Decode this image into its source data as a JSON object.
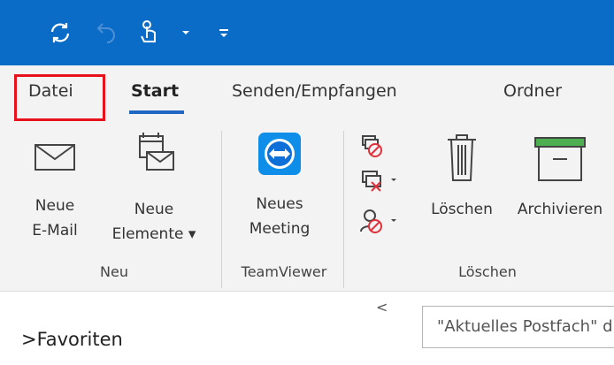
{
  "qat": {
    "items": [
      {
        "name": "sync-icon"
      },
      {
        "name": "undo-icon"
      },
      {
        "name": "touch-mode-icon"
      },
      {
        "name": "dropdown-icon"
      },
      {
        "name": "customize-icon"
      }
    ],
    "bg_color": "#0a6cc6"
  },
  "tabs": {
    "items": [
      {
        "label": "Datei"
      },
      {
        "label": "Start"
      },
      {
        "label": "Senden/Empfangen"
      },
      {
        "label": "Ordner"
      }
    ],
    "active": "Start",
    "highlight_color": "#e8101a"
  },
  "ribbon": {
    "groups": [
      {
        "label": "Neu",
        "buttons": [
          {
            "line1": "Neue",
            "line2": "E-Mail",
            "icon": "envelope-icon"
          },
          {
            "line1": "Neue",
            "line2": "Elemente ▾",
            "icon": "new-items-icon"
          }
        ]
      },
      {
        "label": "TeamViewer",
        "buttons": [
          {
            "line1": "Neues",
            "line2": "Meeting",
            "icon": "teamviewer-icon"
          }
        ]
      },
      {
        "label": "Löschen",
        "buttons": [
          {
            "line1": "Löschen",
            "icon": "trash-icon"
          },
          {
            "line1": "Archivieren",
            "icon": "archive-icon"
          }
        ],
        "small_icons": [
          "ignore-icon",
          "cleanup-icon",
          "junk-icon"
        ]
      }
    ]
  },
  "nav": {
    "collapse": "<",
    "favorites": "Favoriten",
    "search_placeholder": "\"Aktuelles Postfach\" durchsuchen"
  }
}
